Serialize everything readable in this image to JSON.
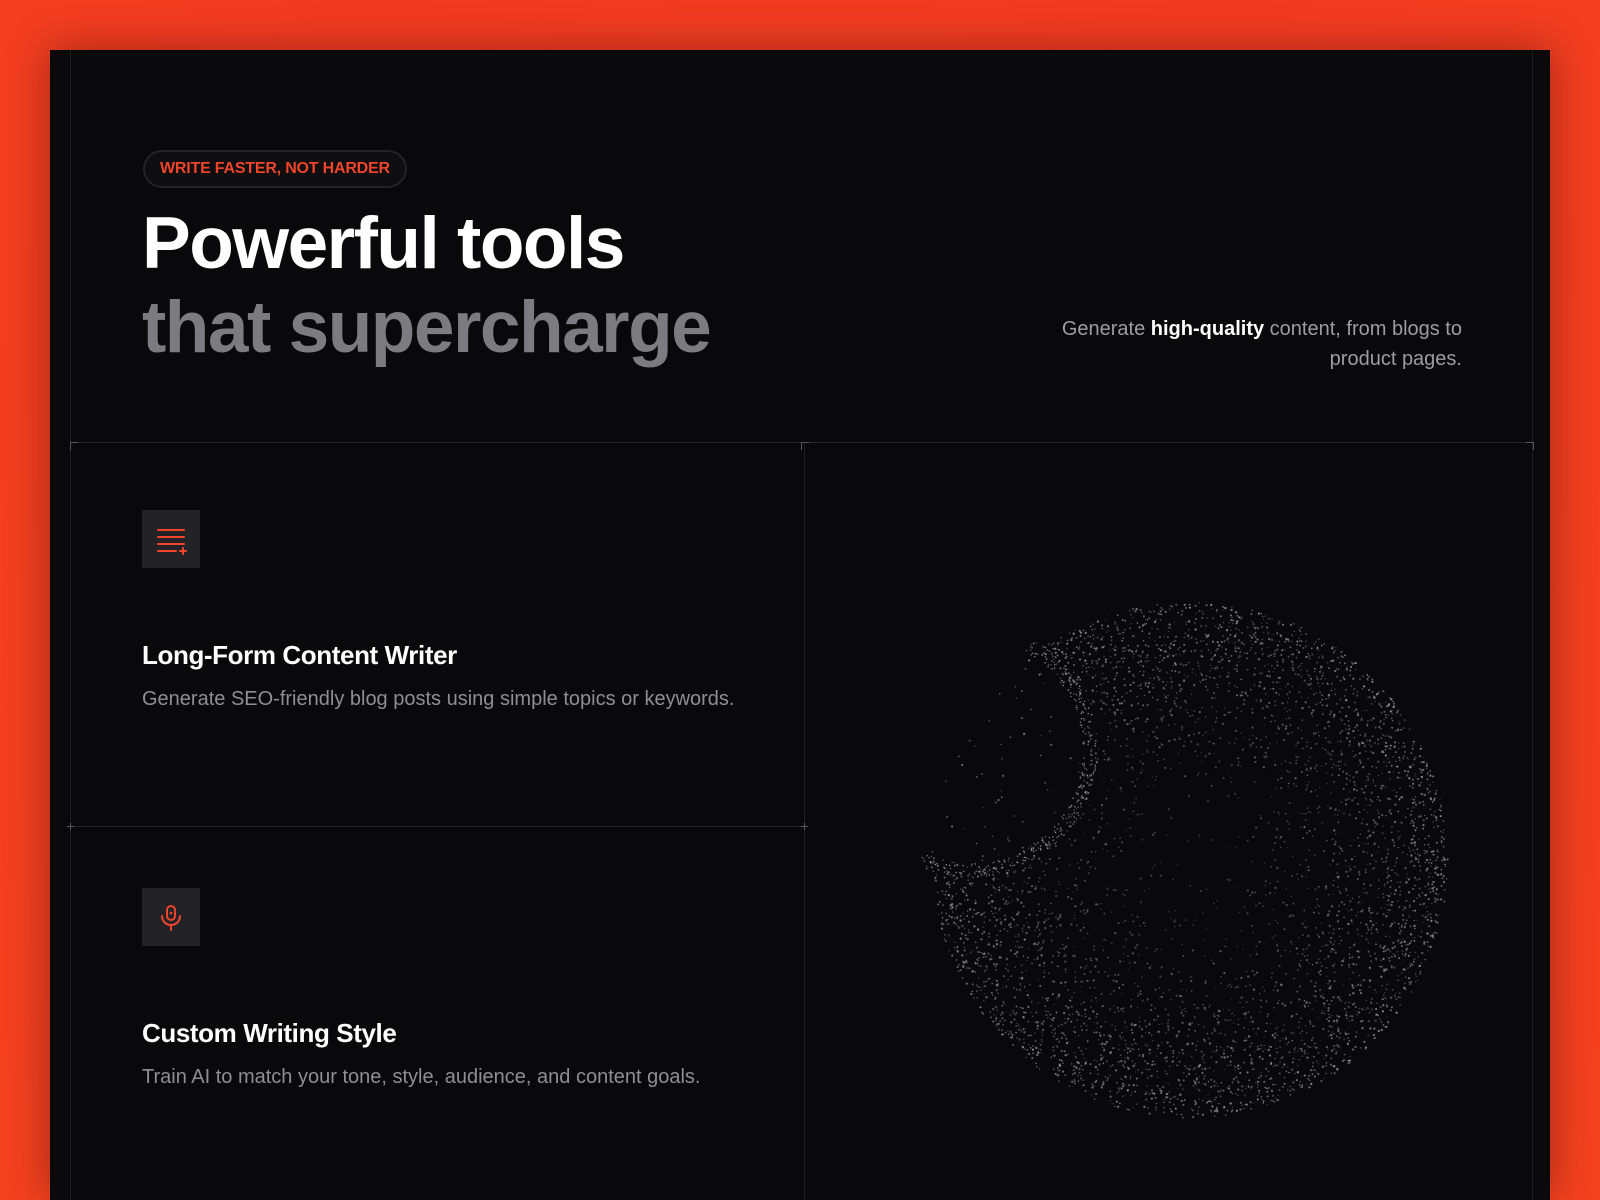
{
  "hero": {
    "badge": "WRITE FASTER, NOT HARDER",
    "title_line1": "Powerful tools",
    "title_line2": "that supercharge",
    "lede_prefix": "Generate ",
    "lede_highlight": "high-quality",
    "lede_suffix": " content, from blogs to product pages."
  },
  "features": [
    {
      "icon": "text-lines-add-icon",
      "title": "Long-Form Content Writer",
      "description": "Generate SEO-friendly blog posts using simple topics or keywords."
    },
    {
      "icon": "microphone-icon",
      "title": "Custom Writing Style",
      "description": "Train AI to match your tone, style, audience, and content goals."
    }
  ],
  "colors": {
    "accent": "#f0452a",
    "background": "#09090b",
    "page": "#f33b22"
  }
}
